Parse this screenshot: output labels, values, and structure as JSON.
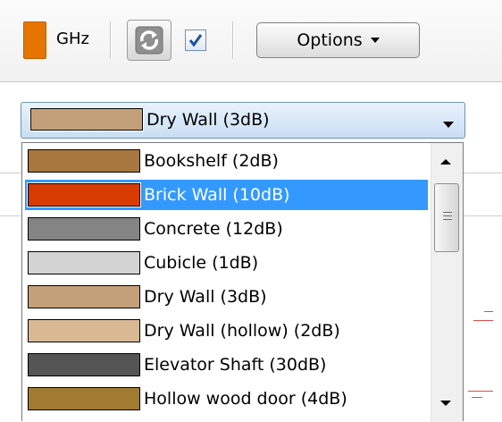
{
  "toolbar": {
    "band_label": "GHz",
    "band_color": "#e57400",
    "refresh_icon": "refresh-icon",
    "checkbox_checked": true,
    "options_label": "Options"
  },
  "combo": {
    "selected_label": "Dry Wall (3dB)",
    "selected_color": "#c4a07a"
  },
  "materials": [
    {
      "label": "Bookshelf (2dB)",
      "color": "#a8773f",
      "selected": false
    },
    {
      "label": "Brick Wall (10dB)",
      "color": "#d83b00",
      "selected": true
    },
    {
      "label": "Concrete (12dB)",
      "color": "#848484",
      "selected": false
    },
    {
      "label": "Cubicle (1dB)",
      "color": "#d3d3d3",
      "selected": false
    },
    {
      "label": "Dry Wall (3dB)",
      "color": "#c4a07a",
      "selected": false
    },
    {
      "label": "Dry Wall (hollow) (2dB)",
      "color": "#d8b994",
      "selected": false
    },
    {
      "label": "Elevator Shaft (30dB)",
      "color": "#555555",
      "selected": false
    },
    {
      "label": "Hollow wood door (4dB)",
      "color": "#a27b32",
      "selected": false
    }
  ]
}
